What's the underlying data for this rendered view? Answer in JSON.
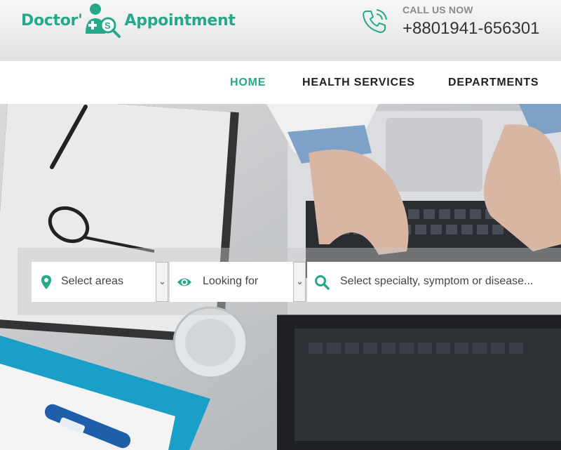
{
  "brand": {
    "name_left": "Doctor'",
    "name_right": "Appointment",
    "color": "#26a88a"
  },
  "contact": {
    "label": "CALL US NOW",
    "phone": "+8801941-656301",
    "icon": "phone-icon"
  },
  "nav": {
    "items": [
      {
        "label": "HOME",
        "active": true
      },
      {
        "label": "HEALTH SERVICES",
        "active": false
      },
      {
        "label": "DEPARTMENTS",
        "active": false
      }
    ]
  },
  "search": {
    "area": {
      "placeholder": "Select areas",
      "icon": "map-pin-icon"
    },
    "looking_for": {
      "placeholder": "Looking for",
      "icon": "eye-icon"
    },
    "specialty": {
      "placeholder": "Select specialty, symptom or disease...",
      "icon": "search-icon"
    }
  },
  "hero": {
    "image": "doctor desk with laptop, clipboard, glasses and thermometer"
  }
}
